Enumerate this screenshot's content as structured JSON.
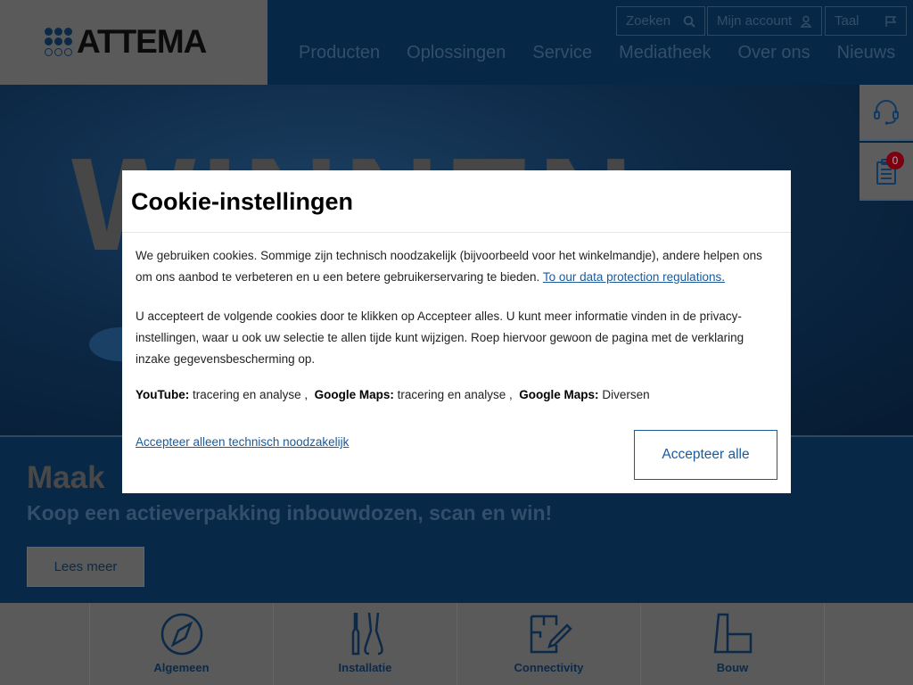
{
  "header": {
    "logo_text": "ATTEMA",
    "search_label": "Zoeken",
    "account_label": "Mijn account",
    "language_label": "Taal",
    "nav": [
      "Producten",
      "Oplossingen",
      "Service",
      "Mediatheek",
      "Over ons",
      "Nieuws"
    ]
  },
  "hero": {
    "word": "WINNEN",
    "promo_title": "Maak",
    "promo_subtitle": "Koop een actieverpakking inbouwdozen, scan en win!",
    "promo_button": "Lees meer"
  },
  "side": {
    "support_icon": "headset-icon",
    "list_icon": "clipboard-icon",
    "list_count": "0"
  },
  "categories": [
    {
      "label": "Algemeen",
      "icon": "compass-icon"
    },
    {
      "label": "Installatie",
      "icon": "tools-icon"
    },
    {
      "label": "Connectivity",
      "icon": "floorplan-edit-icon"
    },
    {
      "label": "Bouw",
      "icon": "building-icon"
    }
  ],
  "modal": {
    "title": "Cookie-instellingen",
    "para1": "We gebruiken cookies. Sommige zijn technisch noodzakelijk (bijvoorbeeld voor het winkelmandje), andere helpen ons om ons aanbod te verbeteren en u een betere gebruikerservaring te bieden.",
    "privacy_link": "To our data protection regulations.",
    "para2": "U accepteert de volgende cookies door te klikken op Accepteer alles. U kunt meer informatie vinden in de privacy-instellingen, waar u ook uw selectie te allen tijde kunt wijzigen. Roep hiervoor gewoon de pagina met de verklaring inzake gegevensbescherming op.",
    "cookies": [
      {
        "name": "YouTube:",
        "purpose": "tracering en analyse",
        "sep": ","
      },
      {
        "name": "Google Maps:",
        "purpose": "tracering en analyse",
        "sep": ","
      },
      {
        "name": "Google Maps:",
        "purpose": "Diversen",
        "sep": ""
      }
    ],
    "necessary_link": "Accepteer alleen technisch noodzakelijk",
    "accept_all": "Accepteer alle"
  },
  "colors": {
    "brand_blue": "#13416e",
    "link_blue": "#1a5a9a",
    "badge_red": "#c0001a"
  }
}
